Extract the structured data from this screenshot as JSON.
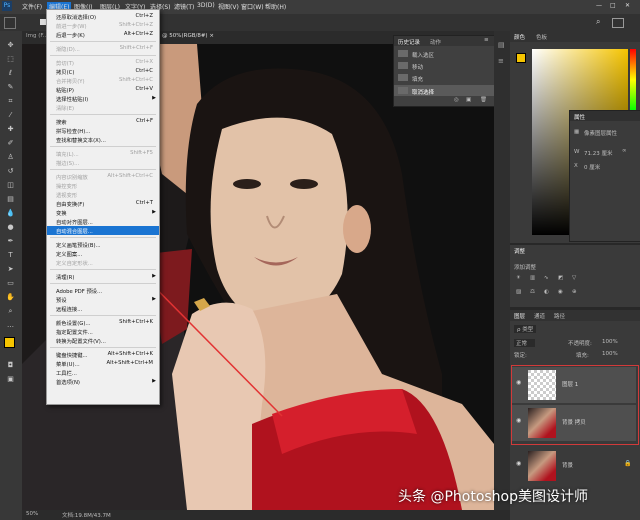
{
  "menubar": {
    "items": [
      "文件(F)",
      "编辑(E)",
      "图像(I)",
      "图层(L)",
      "文字(Y)",
      "选择(S)",
      "滤镜(T)",
      "3D(D)",
      "视图(V)",
      "窗口(W)",
      "帮助(H)"
    ]
  },
  "doc_tabs": {
    "left_tab": "Img (F...",
    "main_tab": "@ 50%(RGB/8#) ×"
  },
  "edit_menu": {
    "items": [
      {
        "label": "还原取消选择(O)",
        "shortcut": "Ctrl+Z",
        "disabled": false
      },
      {
        "label": "前进一步(W)",
        "shortcut": "Shift+Ctrl+Z",
        "disabled": true
      },
      {
        "label": "后退一步(K)",
        "shortcut": "Alt+Ctrl+Z",
        "disabled": false
      },
      {
        "sep": true
      },
      {
        "label": "渐隐(D)...",
        "shortcut": "Shift+Ctrl+F",
        "disabled": true
      },
      {
        "sep": true
      },
      {
        "label": "剪切(T)",
        "shortcut": "Ctrl+X",
        "disabled": true
      },
      {
        "label": "拷贝(C)",
        "shortcut": "Ctrl+C",
        "disabled": false
      },
      {
        "label": "合并拷贝(Y)",
        "shortcut": "Shift+Ctrl+C",
        "disabled": true
      },
      {
        "label": "粘贴(P)",
        "shortcut": "Ctrl+V",
        "disabled": false
      },
      {
        "label": "选择性粘贴(I)",
        "shortcut": "",
        "disabled": false,
        "submenu": true
      },
      {
        "label": "清除(E)",
        "shortcut": "",
        "disabled": true
      },
      {
        "sep": true
      },
      {
        "label": "搜索",
        "shortcut": "Ctrl+F",
        "disabled": false
      },
      {
        "label": "拼写检查(H)...",
        "shortcut": "",
        "disabled": false
      },
      {
        "label": "查找和替换文本(X)...",
        "shortcut": "",
        "disabled": false
      },
      {
        "sep": true
      },
      {
        "label": "填充(L)...",
        "shortcut": "Shift+F5",
        "disabled": true
      },
      {
        "label": "描边(S)...",
        "shortcut": "",
        "disabled": true
      },
      {
        "sep": true
      },
      {
        "label": "内容识别缩放",
        "shortcut": "Alt+Shift+Ctrl+C",
        "disabled": true
      },
      {
        "label": "操控变形",
        "shortcut": "",
        "disabled": true
      },
      {
        "label": "透视变形",
        "shortcut": "",
        "disabled": true
      },
      {
        "label": "自由变换(F)",
        "shortcut": "Ctrl+T",
        "disabled": false
      },
      {
        "label": "变换",
        "shortcut": "",
        "disabled": false,
        "submenu": true
      },
      {
        "label": "自动对齐图层...",
        "shortcut": "",
        "disabled": false
      },
      {
        "label": "自动混合图层...",
        "shortcut": "",
        "disabled": false,
        "highlight": true
      },
      {
        "sep": true
      },
      {
        "label": "定义画笔预设(B)...",
        "shortcut": "",
        "disabled": false
      },
      {
        "label": "定义图案...",
        "shortcut": "",
        "disabled": false
      },
      {
        "label": "定义自定形状...",
        "shortcut": "",
        "disabled": true
      },
      {
        "sep": true
      },
      {
        "label": "清理(R)",
        "shortcut": "",
        "disabled": false,
        "submenu": true
      },
      {
        "sep": true
      },
      {
        "label": "Adobe PDF 预设...",
        "shortcut": "",
        "disabled": false
      },
      {
        "label": "预设",
        "shortcut": "",
        "disabled": false,
        "submenu": true
      },
      {
        "label": "远程连接...",
        "shortcut": "",
        "disabled": false
      },
      {
        "sep": true
      },
      {
        "label": "颜色设置(G)...",
        "shortcut": "Shift+Ctrl+K",
        "disabled": false
      },
      {
        "label": "指定配置文件...",
        "shortcut": "",
        "disabled": false
      },
      {
        "label": "转换为配置文件(V)...",
        "shortcut": "",
        "disabled": false
      },
      {
        "sep": true
      },
      {
        "label": "键盘快捷键...",
        "shortcut": "Alt+Shift+Ctrl+K",
        "disabled": false
      },
      {
        "label": "菜单(U)...",
        "shortcut": "Alt+Shift+Ctrl+M",
        "disabled": false
      },
      {
        "label": "工具栏...",
        "shortcut": "",
        "disabled": false
      },
      {
        "label": "首选项(N)",
        "shortcut": "",
        "disabled": false,
        "submenu": true
      }
    ]
  },
  "history_panel": {
    "tabs": [
      "历史记录",
      "动作"
    ],
    "rows": [
      "载入选区",
      "移动",
      "填充",
      "取消选择"
    ]
  },
  "color_panel": {
    "tabs": [
      "颜色",
      "色板"
    ]
  },
  "properties_panel": {
    "title": "属性",
    "subtitle": "像素图层属性",
    "w_label": "W",
    "w_value": "71.23 厘米",
    "x_label": "X",
    "x_value": "0 厘米"
  },
  "adjust_panel": {
    "title": "调整",
    "subtitle": "添加调整"
  },
  "layers_panel": {
    "tabs": [
      "图层",
      "通道",
      "路径"
    ],
    "kind_label": "ρ 类型",
    "blend_mode": "正常",
    "opacity_label": "不透明度:",
    "opacity_value": "100%",
    "lock_label": "锁定:",
    "fill_label": "填充:",
    "fill_value": "100%",
    "layers": [
      {
        "name": "图层 1",
        "selected": true
      },
      {
        "name": "背景 拷贝",
        "selected": true
      },
      {
        "name": "背景",
        "selected": false
      }
    ]
  },
  "status_bar": {
    "zoom": "50%",
    "doc": "文档:19.8M/43.7M"
  },
  "watermark": "头条 @Photoshop美图设计师",
  "colors": {
    "accent": "#1a74d2",
    "highlight_box": "#d23a3a",
    "fg_swatch": "#f5c400"
  }
}
